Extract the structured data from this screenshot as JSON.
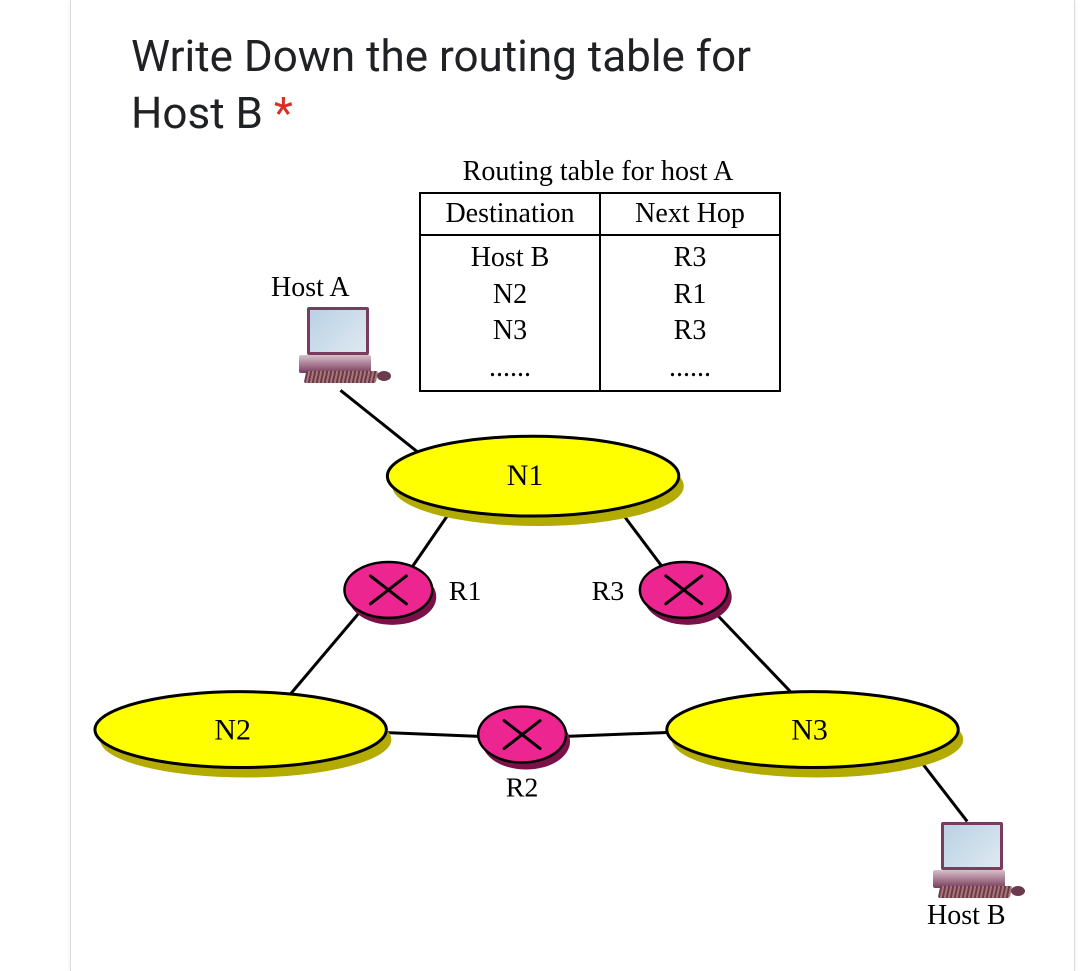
{
  "question": {
    "text_line1": "Write Down the routing table for",
    "text_line2": "Host B ",
    "required_mark": "*"
  },
  "routing_table": {
    "caption": "Routing table for host A",
    "header_dest": "Destination",
    "header_next": "Next Hop",
    "rows": [
      {
        "dest": "Host B",
        "next": "R3"
      },
      {
        "dest": "N2",
        "next": "R1"
      },
      {
        "dest": "N3",
        "next": "R3"
      },
      {
        "dest": "......",
        "next": "......"
      }
    ]
  },
  "hosts": {
    "A": "Host A",
    "B": "Host B"
  },
  "networks": {
    "N1": "N1",
    "N2": "N2",
    "N3": "N3"
  },
  "routers": {
    "R1": "R1",
    "R2": "R2",
    "R3": "R3"
  }
}
